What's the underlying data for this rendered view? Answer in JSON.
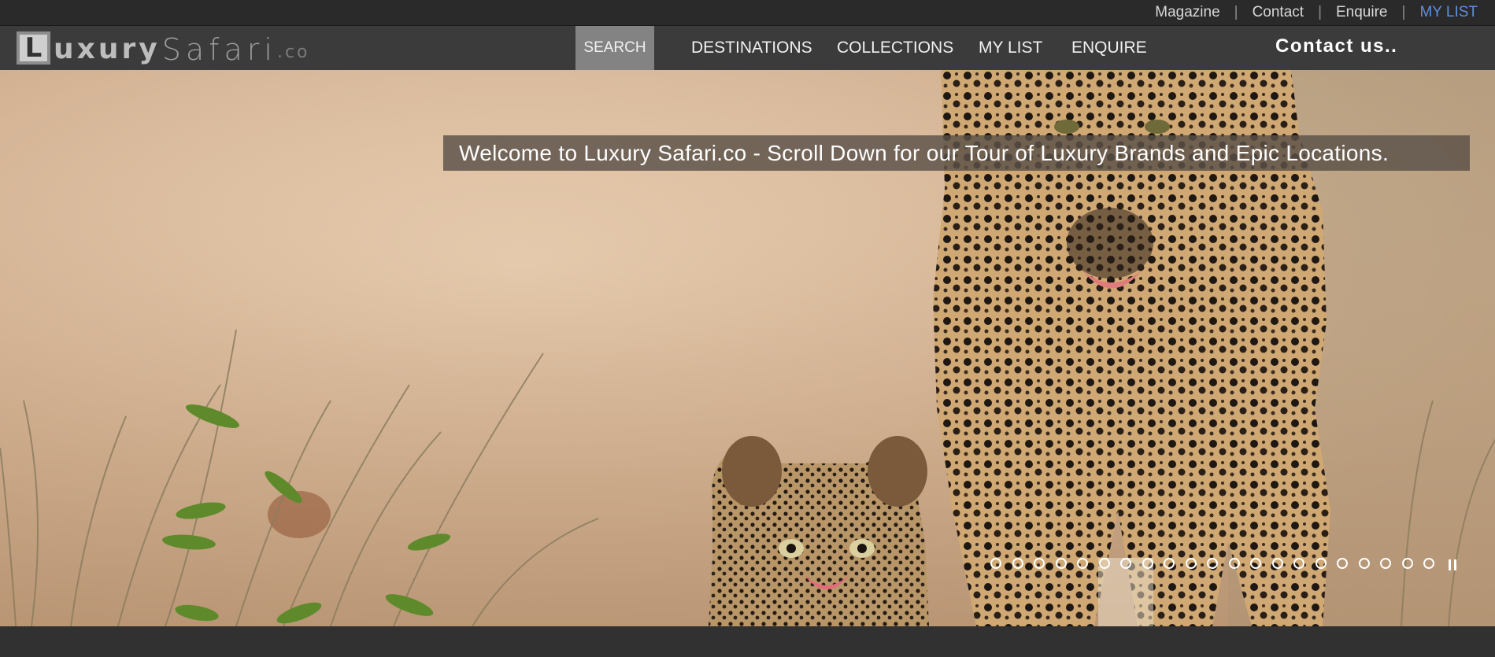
{
  "utility_nav": {
    "items": [
      "Magazine",
      "Contact",
      "Enquire",
      "MY LIST"
    ],
    "separator": "|",
    "mylist_color": "#5e8ee0"
  },
  "logo": {
    "first_letter": "L",
    "part1": "uxury",
    "part2": "Safari",
    "suffix": ".co"
  },
  "main_nav": {
    "search": "SEARCH",
    "destinations": "DESTINATIONS",
    "collections": "COLLECTIONS",
    "my_list": "MY LIST",
    "enquire": "ENQUIRE"
  },
  "contact_us": "Contact us..",
  "hero": {
    "banner_text": "Welcome to Luxury Safari.co - Scroll Down for our Tour of Luxury Brands and Epic Locations.",
    "image_subject": "leopard-and-cub",
    "slide_count": 21,
    "pause_icon": "pause-icon"
  },
  "colors": {
    "util_bg": "#2a2a2a",
    "nav_bg": "#3b3b3b",
    "search_active_bg": "#838383",
    "banner_bg": "rgba(90,80,72,0.82)"
  }
}
